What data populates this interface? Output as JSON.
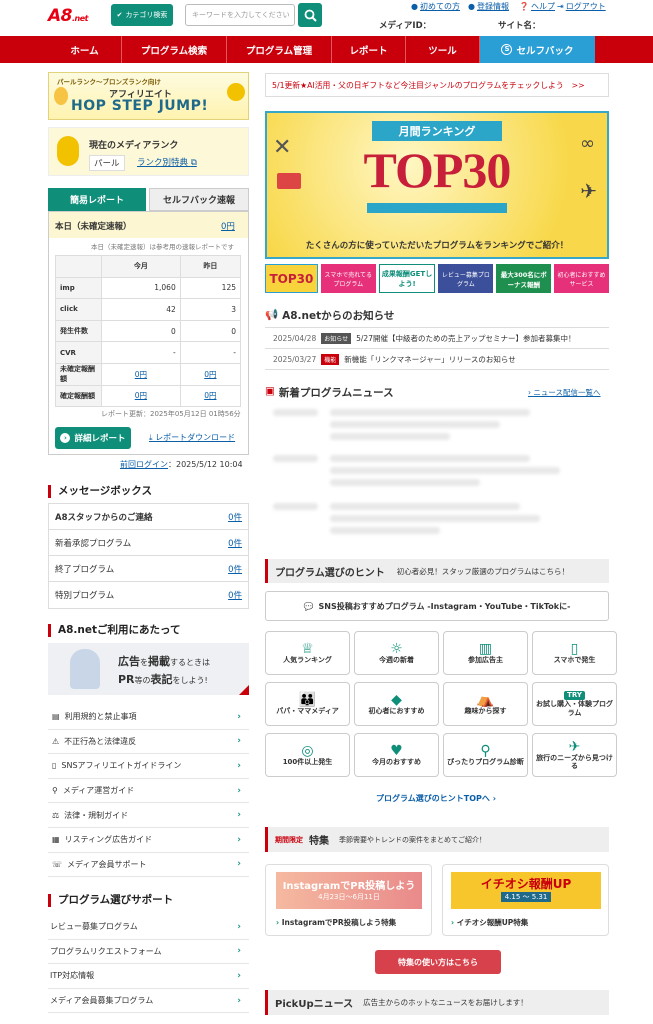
{
  "header": {
    "logo": "A8",
    "logo_suffix": ".net",
    "category_search": "カテゴリ検索",
    "keyword_placeholder": "キーワードを入力してください",
    "links": [
      "初めての方",
      "登録情報",
      "ヘルプ",
      "ログアウト"
    ],
    "media_id_label": "メディアID：",
    "site_name_label": "サイト名："
  },
  "nav": [
    "ホーム",
    "プログラム検索",
    "プログラム管理",
    "レポート",
    "ツール",
    "セルフバック"
  ],
  "left": {
    "banner_line1": "パールランク〜ブロンズランク向け",
    "banner_line2": "アフィリエイト",
    "banner_line3": "HOP STEP JUMP!",
    "rank_title": "現在のメディアランク",
    "rank_value": "パール",
    "rank_link": "ランク別特典",
    "tab_report": "簡易レポート",
    "tab_selfback": "セルフバック速報",
    "today_label": "本日（未確定速報）",
    "today_value": "0円",
    "today_note": "本日（未確定速報）は参考用の速報レポートです",
    "col_month": "今月",
    "col_yesterday": "昨日",
    "rows": [
      {
        "label": "imp",
        "month": "1,060",
        "yday": "125",
        "link": false
      },
      {
        "label": "click",
        "month": "42",
        "yday": "3",
        "link": false
      },
      {
        "label": "発生件数",
        "month": "0",
        "yday": "0",
        "link": false
      },
      {
        "label": "CVR",
        "month": "-",
        "yday": "-",
        "link": false
      },
      {
        "label": "未確定報酬額",
        "month": "0円",
        "yday": "0円",
        "link": true
      },
      {
        "label": "確定報酬額",
        "month": "0円",
        "yday": "0円",
        "link": true
      }
    ],
    "report_updated": "レポート更新：2025年05月12日 01時56分",
    "detail_btn": "詳細レポート",
    "download": "レポートダウンロード",
    "last_login_label": "前回ログイン",
    "last_login_value": "：2025/5/12 10:04",
    "msg_title": "メッセージボックス",
    "messages": [
      {
        "label": "A8スタッフからのご連絡",
        "count": "0件"
      },
      {
        "label": "新着承認プログラム",
        "count": "0件"
      },
      {
        "label": "終了プログラム",
        "count": "0件"
      },
      {
        "label": "特別プログラム",
        "count": "0件"
      }
    ],
    "use_title": "A8.netご利用にあたって",
    "pr_text_a": "広告",
    "pr_text_b": "を",
    "pr_text_c": "掲載",
    "pr_text_d": "するときは",
    "pr_text_e": "PR",
    "pr_text_f": "等の",
    "pr_text_g": "表記",
    "pr_text_h": "をしよう!",
    "use_links": [
      "利用規約と禁止事項",
      "不正行為と法律違反",
      "SNSアフィリエイトガイドライン",
      "メディア運営ガイド",
      "法律・規制ガイド",
      "リスティング広告ガイド",
      "メディア会員サポート"
    ],
    "support_title": "プログラム選びサポート",
    "support_links": [
      "レビュー募集プログラム",
      "プログラムリクエストフォーム",
      "ITP対応情報",
      "メディア会員募集プログラム"
    ]
  },
  "right": {
    "update_text": "5/1更新★AI活用・父の日ギフトなど今注目ジャンルのプログラムをチェックしよう",
    "update_arrow": ">>",
    "top_ribbon": "月間ランキング",
    "top_big": "TOP30",
    "top_sub": "たくさんの方に使っていただいたプログラムをランキングでご紹介！",
    "minibanners": [
      "TOP30",
      "スマホで売れてるプログラム",
      "成果報酬GETしよう!",
      "レビュー募集プログラム",
      "最大300名にボーナス報酬",
      "初心者におすすめサービス"
    ],
    "news_title": "A8.netからのお知らせ",
    "news": [
      {
        "date": "2025/04/28",
        "tag": "お知らせ",
        "text": "5/27開催【中級者のための売上アップセミナー】参加者募集中！"
      },
      {
        "date": "2025/03/27",
        "tag": "機能",
        "text": "新機能「リンクマネージャー」リリースのお知らせ"
      }
    ],
    "newprog_title": "新着プログラムニュース",
    "newprog_link": "ニュース配信一覧へ",
    "hint_title": "プログラム選びのヒント",
    "hint_sub": "初心者必見！スタッフ厳選のプログラムはこちら！",
    "sns_btn": "SNS投稿おすすめプログラム -Instagram・YouTube・TikTokに-",
    "hints": [
      "人気ランキング",
      "今週の新着",
      "参加広告主",
      "スマホで発生",
      "パパ・ママメディア",
      "初心者におすすめ",
      "趣味から探す",
      "お試し購入・体験プログラム",
      "100件以上発生",
      "今月のおすすめ",
      "ぴったりプログラム診断",
      "旅行のニーズから見つける"
    ],
    "hint_icons": [
      "♕",
      "☼",
      "▥",
      "▯",
      "👪",
      "◆",
      "⛺",
      "TRY",
      "◎",
      "♥",
      "⚲",
      "✈"
    ],
    "hint_top": "プログラム選びのヒントTOPへ",
    "special_tag": "期間限定",
    "special_title": "特集",
    "special_sub": "季節需要やトレンドの案件をまとめてご紹介！",
    "special1_banner": "InstagramでPR投稿しよう",
    "special1_dates": "4月23日〜6月11日",
    "special1_label": "InstagramでPR投稿しよう特集",
    "special2_banner": "イチオシ報酬UP",
    "special2_dates": "4.15 〜 5.31",
    "special2_label": "イチオシ報酬UP特集",
    "special_btn": "特集の使い方はこちら",
    "pickup_title": "PickUpニュース",
    "pickup_sub": "広告主からのホットなニュースをお届けします！"
  },
  "colors": {
    "brand_red": "#c9000c",
    "teal": "#0f8f7a",
    "blue": "#2a9fd6",
    "link": "#0b5ea8"
  }
}
